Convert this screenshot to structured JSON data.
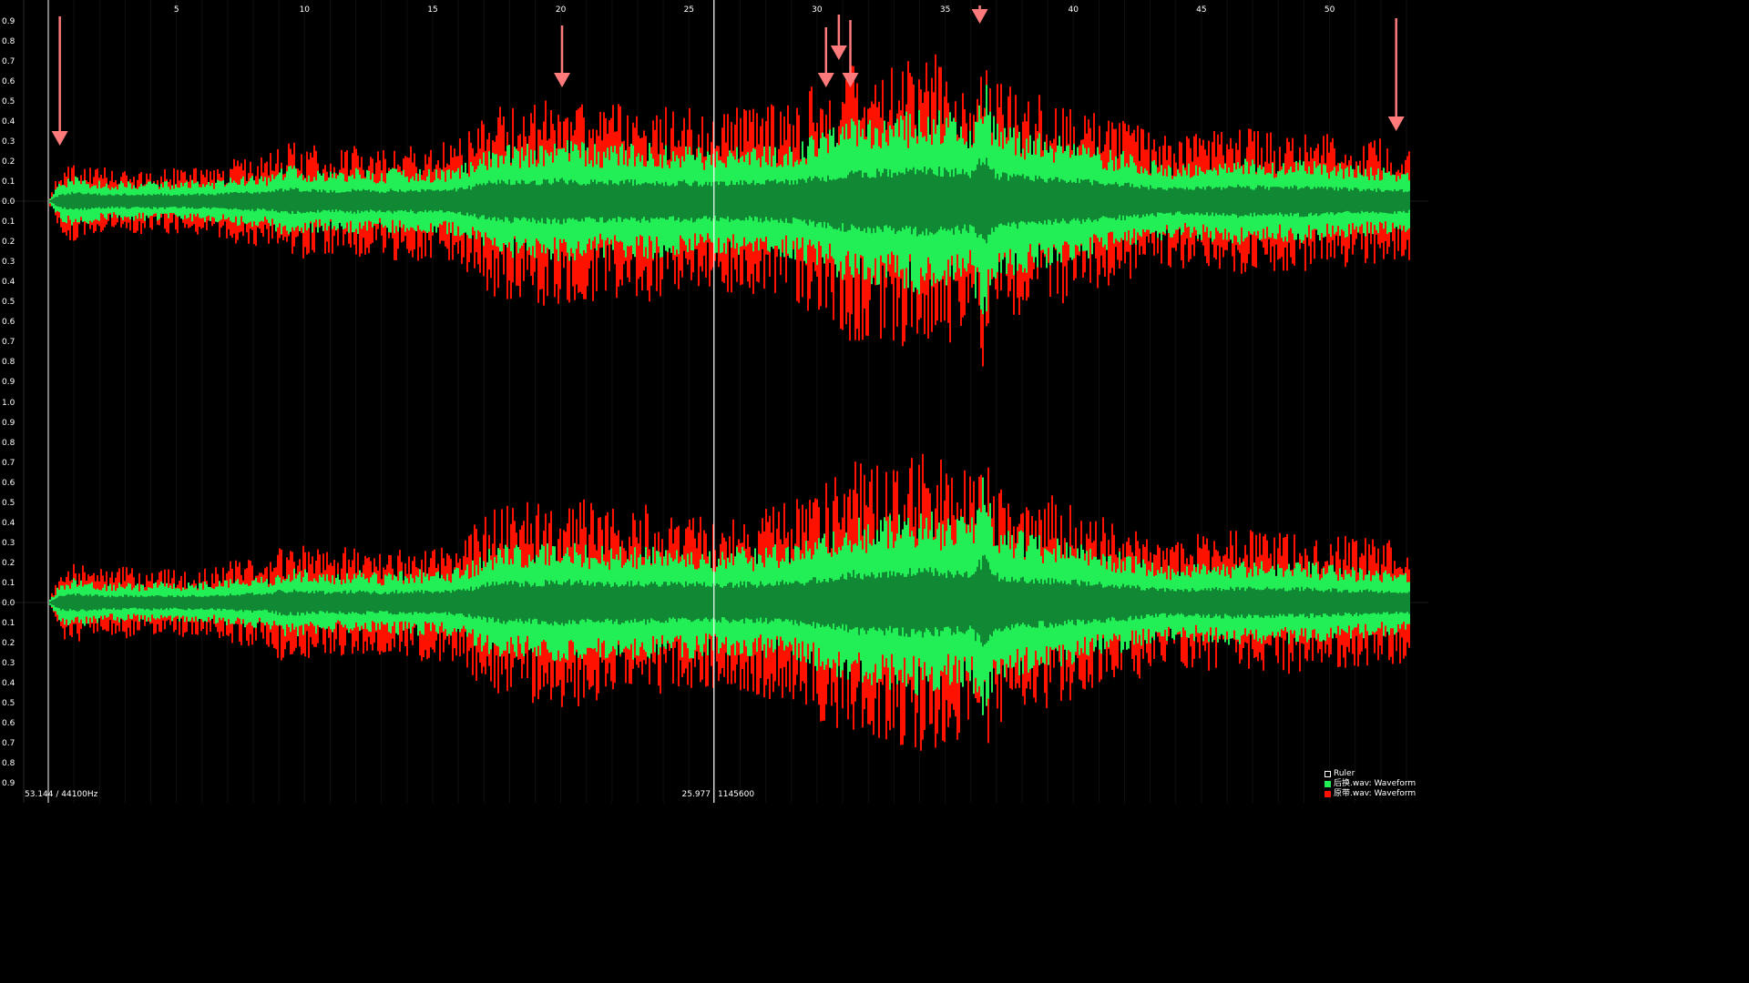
{
  "chart_data": {
    "type": "area",
    "title": "",
    "xlabel": "",
    "ylabel": "",
    "xlim": [
      0,
      53.144
    ],
    "ylim": [
      -1.0,
      1.0
    ],
    "x_ticks": [
      5,
      10,
      15,
      20,
      25,
      30,
      35,
      40,
      45,
      50
    ],
    "y_tick_labels": [
      "1.0",
      "0.9",
      "0.8",
      "0.7",
      "0.6",
      "0.5",
      "0.4",
      "0.3",
      "0.2",
      "0.1",
      "0.0",
      "0.1",
      "0.2",
      "0.3",
      "0.4",
      "0.5",
      "0.6",
      "0.7",
      "0.8",
      "0.9"
    ],
    "channels": 2,
    "x": [
      0.0,
      0.5,
      1.0,
      1.5,
      2.0,
      2.5,
      3.0,
      3.5,
      4.0,
      4.5,
      5.0,
      5.5,
      6.0,
      6.5,
      7.0,
      7.5,
      8.0,
      8.5,
      9.0,
      9.5,
      10.0,
      10.5,
      11.0,
      11.5,
      12.0,
      12.5,
      13.0,
      13.5,
      14.0,
      14.5,
      15.0,
      15.5,
      16.0,
      16.5,
      17.0,
      17.5,
      18.0,
      18.5,
      19.0,
      19.5,
      20.0,
      20.5,
      21.0,
      21.5,
      22.0,
      22.5,
      23.0,
      23.5,
      24.0,
      24.5,
      25.0,
      25.5,
      26.0,
      26.5,
      27.0,
      27.5,
      28.0,
      28.5,
      29.0,
      29.5,
      30.0,
      30.5,
      31.0,
      31.5,
      32.0,
      32.5,
      33.0,
      33.5,
      34.0,
      34.5,
      35.0,
      35.5,
      36.0,
      36.5,
      37.0,
      37.5,
      38.0,
      38.5,
      39.0,
      39.5,
      40.0,
      40.5,
      41.0,
      41.5,
      42.0,
      42.5,
      43.0,
      43.5,
      44.0,
      44.5,
      45.0,
      45.5,
      46.0,
      46.5,
      47.0,
      47.5,
      48.0,
      48.5,
      49.0,
      49.5,
      50.0,
      50.5,
      51.0,
      51.5,
      52.0,
      52.5,
      53.0
    ],
    "series": [
      {
        "name": "后换.wav: Waveform",
        "color": "#22ee55",
        "core_color": "#118833",
        "values": [
          0.0,
          0.1,
          0.12,
          0.11,
          0.1,
          0.09,
          0.1,
          0.09,
          0.1,
          0.1,
          0.09,
          0.1,
          0.1,
          0.1,
          0.11,
          0.12,
          0.13,
          0.12,
          0.16,
          0.17,
          0.16,
          0.15,
          0.14,
          0.15,
          0.16,
          0.15,
          0.14,
          0.16,
          0.15,
          0.16,
          0.15,
          0.16,
          0.17,
          0.2,
          0.25,
          0.27,
          0.28,
          0.27,
          0.28,
          0.29,
          0.3,
          0.29,
          0.28,
          0.27,
          0.27,
          0.28,
          0.27,
          0.28,
          0.27,
          0.26,
          0.27,
          0.26,
          0.25,
          0.26,
          0.27,
          0.26,
          0.27,
          0.28,
          0.28,
          0.3,
          0.33,
          0.35,
          0.38,
          0.42,
          0.4,
          0.41,
          0.42,
          0.43,
          0.45,
          0.44,
          0.43,
          0.42,
          0.4,
          0.62,
          0.38,
          0.36,
          0.35,
          0.33,
          0.32,
          0.31,
          0.3,
          0.28,
          0.26,
          0.25,
          0.24,
          0.22,
          0.2,
          0.19,
          0.18,
          0.18,
          0.19,
          0.2,
          0.2,
          0.21,
          0.2,
          0.2,
          0.19,
          0.2,
          0.2,
          0.19,
          0.18,
          0.18,
          0.17,
          0.17,
          0.16,
          0.16,
          0.15
        ]
      },
      {
        "name": "原带.wav: Waveform",
        "color": "#ff1100",
        "values": [
          0.0,
          0.15,
          0.17,
          0.15,
          0.14,
          0.14,
          0.15,
          0.14,
          0.13,
          0.14,
          0.14,
          0.15,
          0.14,
          0.15,
          0.17,
          0.18,
          0.19,
          0.18,
          0.24,
          0.25,
          0.24,
          0.23,
          0.22,
          0.23,
          0.24,
          0.23,
          0.22,
          0.25,
          0.24,
          0.25,
          0.24,
          0.25,
          0.26,
          0.31,
          0.38,
          0.4,
          0.41,
          0.42,
          0.43,
          0.44,
          0.45,
          0.44,
          0.43,
          0.41,
          0.4,
          0.42,
          0.4,
          0.42,
          0.4,
          0.38,
          0.4,
          0.38,
          0.37,
          0.38,
          0.4,
          0.39,
          0.4,
          0.41,
          0.42,
          0.45,
          0.5,
          0.53,
          0.56,
          0.6,
          0.57,
          0.58,
          0.6,
          0.61,
          0.63,
          0.62,
          0.6,
          0.58,
          0.56,
          0.7,
          0.53,
          0.5,
          0.49,
          0.46,
          0.45,
          0.44,
          0.42,
          0.4,
          0.37,
          0.35,
          0.34,
          0.32,
          0.3,
          0.29,
          0.28,
          0.28,
          0.29,
          0.3,
          0.3,
          0.31,
          0.3,
          0.3,
          0.29,
          0.3,
          0.3,
          0.29,
          0.28,
          0.28,
          0.27,
          0.27,
          0.26,
          0.26,
          0.25
        ]
      }
    ],
    "cursor_x": 25.977,
    "markers_x": [
      0.45,
      20.05,
      30.35,
      30.85,
      31.3,
      36.35,
      52.6
    ]
  },
  "status": {
    "duration_rate": "53.144 / 44100Hz",
    "cursor_time": "25.977",
    "cursor_sample": "1145600"
  },
  "legend": {
    "ruler": "Ruler",
    "series_a": "后换.wav: Waveform",
    "series_b": "原带.wav: Waveform"
  },
  "colors": {
    "background": "#000000",
    "ruler": "#ffffff",
    "marker_arrow": "#ff7b7b",
    "series_a": "#22ee55",
    "series_b": "#ff1100"
  }
}
